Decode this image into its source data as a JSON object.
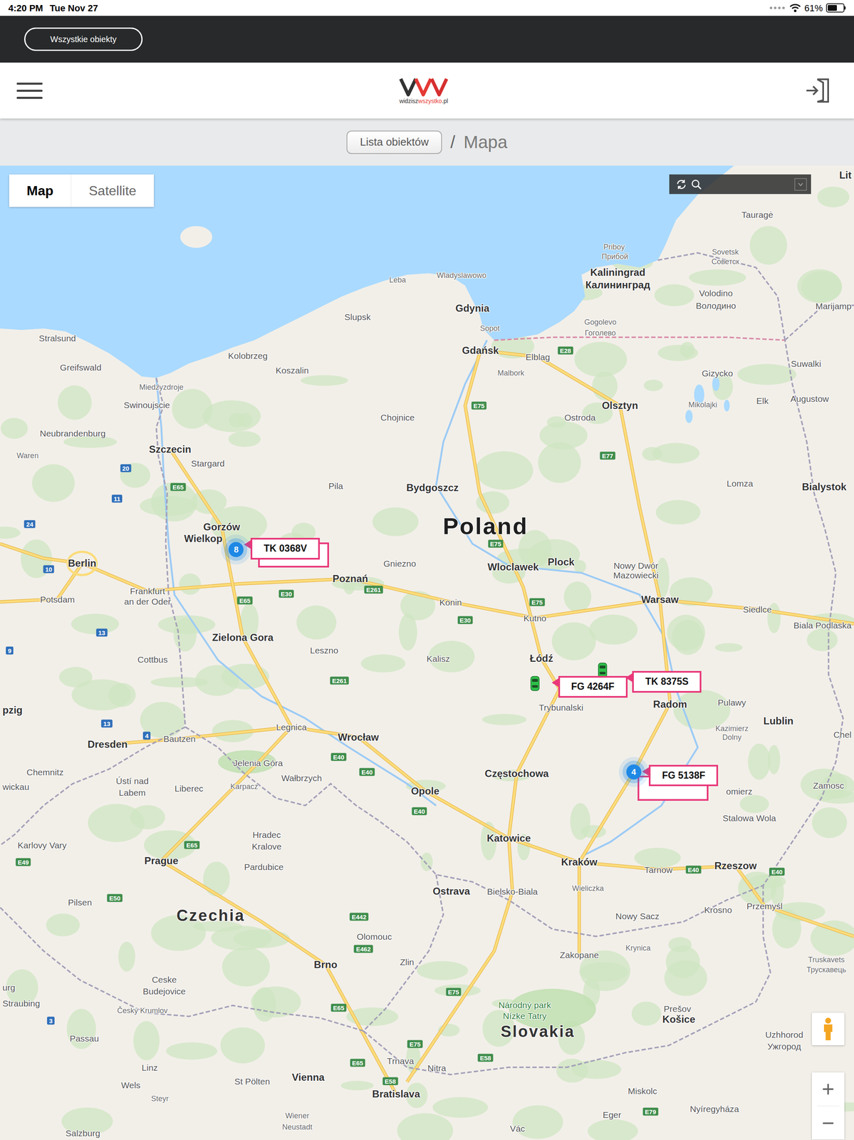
{
  "status_bar": {
    "time": "4:20 PM",
    "date": "Tue Nov 27",
    "battery": "61%",
    "battery_level": 0.61
  },
  "top_bar": {
    "button": "Wszystkie obiekty"
  },
  "header": {
    "logo": [
      {
        "text": "widzisz",
        "color": "#333333"
      },
      {
        "text": "wszystko",
        "color": "#e53935"
      },
      {
        "text": ".pl",
        "color": "#333333"
      }
    ]
  },
  "breadcrumb": {
    "items": [
      {
        "label": "Lista obiektów",
        "kind": "button"
      },
      {
        "label": "Mapa",
        "kind": "current"
      }
    ],
    "separator": "/"
  },
  "map": {
    "map_type": [
      {
        "label": "Map",
        "selected": true
      },
      {
        "label": "Satellite",
        "selected": false
      }
    ],
    "zoom_in": "+",
    "zoom_out": "−",
    "clusters": [
      {
        "count": "8"
      },
      {
        "count": "4"
      }
    ],
    "vehicles": [
      {
        "plate": "TK 0368V"
      },
      {
        "plate": "FG 4264F"
      },
      {
        "plate": "TK 8375S"
      },
      {
        "plate": "FG 5138F"
      }
    ],
    "labels": [
      {
        "text": "Lit",
        "kind": "major"
      },
      {
        "text": "Tauragė",
        "kind": "city"
      },
      {
        "text": "Priboy",
        "kind": "minor"
      },
      {
        "text": "Прибой",
        "kind": "minor"
      },
      {
        "text": "Sovetsk",
        "kind": "minor"
      },
      {
        "text": "Советск",
        "kind": "minor"
      },
      {
        "text": "Kaliningrad",
        "kind": "major"
      },
      {
        "text": "Калининград",
        "kind": "major"
      },
      {
        "text": "Volodino",
        "kind": "city"
      },
      {
        "text": "Володино",
        "kind": "city"
      },
      {
        "text": "Marijamp",
        "kind": "city"
      },
      {
        "text": "Leba",
        "kind": "minor"
      },
      {
        "text": "Wladyslawowo",
        "kind": "minor"
      },
      {
        "text": "Gdynia",
        "kind": "major"
      },
      {
        "text": "Sopot",
        "kind": "minor"
      },
      {
        "text": "Gdańsk",
        "kind": "major"
      },
      {
        "text": "Elblag",
        "kind": "city"
      },
      {
        "text": "Gogolevo",
        "kind": "minor"
      },
      {
        "text": "Гоголево",
        "kind": "minor"
      },
      {
        "text": "Slupsk",
        "kind": "city"
      },
      {
        "text": "Malbork",
        "kind": "minor"
      },
      {
        "text": "Stralsund",
        "kind": "city"
      },
      {
        "text": "Kolobrzeg",
        "kind": "city"
      },
      {
        "text": "Koszalin",
        "kind": "city"
      },
      {
        "text": "Greifswald",
        "kind": "city"
      },
      {
        "text": "Miedzyzdroje",
        "kind": "minor"
      },
      {
        "text": "Swinoujscie",
        "kind": "city"
      },
      {
        "text": "Chojnice",
        "kind": "city"
      },
      {
        "text": "Olsztyn",
        "kind": "major"
      },
      {
        "text": "Ostroda",
        "kind": "city"
      },
      {
        "text": "Gizycko",
        "kind": "city"
      },
      {
        "text": "Suwalki",
        "kind": "city"
      },
      {
        "text": "Mikolajki",
        "kind": "minor"
      },
      {
        "text": "Elk",
        "kind": "city"
      },
      {
        "text": "Augustow",
        "kind": "city"
      },
      {
        "text": "Neubrandenburg",
        "kind": "city"
      },
      {
        "text": "Szczecin",
        "kind": "major"
      },
      {
        "text": "Stargard",
        "kind": "city"
      },
      {
        "text": "Waren",
        "kind": "minor"
      },
      {
        "text": "Pila",
        "kind": "city"
      },
      {
        "text": "Bydgoszcz",
        "kind": "major"
      },
      {
        "text": "Lomza",
        "kind": "city"
      },
      {
        "text": "Bialystok",
        "kind": "major"
      },
      {
        "text": "Poland",
        "kind": "country"
      },
      {
        "text": "Gorzów",
        "kind": "major"
      },
      {
        "text": "Wielkop",
        "kind": "major"
      },
      {
        "text": "Gniezno",
        "kind": "city"
      },
      {
        "text": "Wloclawek",
        "kind": "major"
      },
      {
        "text": "Plock",
        "kind": "major"
      },
      {
        "text": "Nowy Dwór",
        "kind": "city"
      },
      {
        "text": "Mazowiecki",
        "kind": "city"
      },
      {
        "text": "Berlin",
        "kind": "major"
      },
      {
        "text": "Potsdam",
        "kind": "city"
      },
      {
        "text": "Frankfurt",
        "kind": "city"
      },
      {
        "text": "an der Oder",
        "kind": "city"
      },
      {
        "text": "Poznań",
        "kind": "major"
      },
      {
        "text": "Konin",
        "kind": "city"
      },
      {
        "text": "Kutno",
        "kind": "city"
      },
      {
        "text": "Warsaw",
        "kind": "major"
      },
      {
        "text": "Siedlce",
        "kind": "city"
      },
      {
        "text": "Biala Podlaska",
        "kind": "city"
      },
      {
        "text": "Zielona Gora",
        "kind": "major"
      },
      {
        "text": "Cottbus",
        "kind": "city"
      },
      {
        "text": "Leszno",
        "kind": "city"
      },
      {
        "text": "Kalisz",
        "kind": "city"
      },
      {
        "text": "Łódź",
        "kind": "major"
      },
      {
        "text": "Trybunalski",
        "kind": "city"
      },
      {
        "text": "Radom",
        "kind": "major"
      },
      {
        "text": "Pulawy",
        "kind": "city"
      },
      {
        "text": "Kazimierz",
        "kind": "minor"
      },
      {
        "text": "Dolny",
        "kind": "minor"
      },
      {
        "text": "Lublin",
        "kind": "major"
      },
      {
        "text": "Chel",
        "kind": "city"
      },
      {
        "text": "pzig",
        "kind": "major"
      },
      {
        "text": "Legnica",
        "kind": "city"
      },
      {
        "text": "Wrocław",
        "kind": "major"
      },
      {
        "text": "Dresden",
        "kind": "major"
      },
      {
        "text": "Bautzen",
        "kind": "city"
      },
      {
        "text": "Jelenia Góra",
        "kind": "city"
      },
      {
        "text": "Wałbrzych",
        "kind": "city"
      },
      {
        "text": "Częstochowa",
        "kind": "major"
      },
      {
        "text": "omierz",
        "kind": "city"
      },
      {
        "text": "Zamosc",
        "kind": "city"
      },
      {
        "text": "Opole",
        "kind": "major"
      },
      {
        "text": "Chemnitz",
        "kind": "city"
      },
      {
        "text": "Ústí nad",
        "kind": "city"
      },
      {
        "text": "Labem",
        "kind": "city"
      },
      {
        "text": "Liberec",
        "kind": "city"
      },
      {
        "text": "Karpacz",
        "kind": "minor"
      },
      {
        "text": "wickau",
        "kind": "city"
      },
      {
        "text": "Stalowa Wola",
        "kind": "city"
      },
      {
        "text": "Hradec",
        "kind": "city"
      },
      {
        "text": "Kralove",
        "kind": "city"
      },
      {
        "text": "Pardubice",
        "kind": "city"
      },
      {
        "text": "Katowice",
        "kind": "major"
      },
      {
        "text": "Kraków",
        "kind": "major"
      },
      {
        "text": "Tarnow",
        "kind": "city"
      },
      {
        "text": "Rzeszow",
        "kind": "major"
      },
      {
        "text": "Przemyśl",
        "kind": "city"
      },
      {
        "text": "Karlovy Vary",
        "kind": "city"
      },
      {
        "text": "Prague",
        "kind": "major"
      },
      {
        "text": "Czechia",
        "kind": "country2"
      },
      {
        "text": "Ostrava",
        "kind": "major"
      },
      {
        "text": "Bielsko-Biala",
        "kind": "city"
      },
      {
        "text": "Wieliczka",
        "kind": "minor"
      },
      {
        "text": "Nowy Sacz",
        "kind": "city"
      },
      {
        "text": "Krosno",
        "kind": "city"
      },
      {
        "text": "Pilsen",
        "kind": "city"
      },
      {
        "text": "Olomouc",
        "kind": "city"
      },
      {
        "text": "Zlin",
        "kind": "city"
      },
      {
        "text": "Zakopane",
        "kind": "city"
      },
      {
        "text": "Krynica",
        "kind": "minor"
      },
      {
        "text": "Truskavets",
        "kind": "minor"
      },
      {
        "text": "Трускавець",
        "kind": "minor"
      },
      {
        "text": "Ceske",
        "kind": "city"
      },
      {
        "text": "Budejovice",
        "kind": "city"
      },
      {
        "text": "Brno",
        "kind": "major"
      },
      {
        "text": "Prešov",
        "kind": "city"
      },
      {
        "text": "Národný park",
        "kind": "park"
      },
      {
        "text": "Nízke Tatry",
        "kind": "park"
      },
      {
        "text": "Slovakia",
        "kind": "country2"
      },
      {
        "text": "Košice",
        "kind": "major"
      },
      {
        "text": "Uzhhorod",
        "kind": "city"
      },
      {
        "text": "Ужгород",
        "kind": "city"
      },
      {
        "text": "Straubing",
        "kind": "city"
      },
      {
        "text": "urg",
        "kind": "city"
      },
      {
        "text": "Český Krumlov",
        "kind": "minor"
      },
      {
        "text": "Passau",
        "kind": "city"
      },
      {
        "text": "Linz",
        "kind": "city"
      },
      {
        "text": "Wels",
        "kind": "city"
      },
      {
        "text": "Steyr",
        "kind": "minor"
      },
      {
        "text": "St Pölten",
        "kind": "city"
      },
      {
        "text": "Vienna",
        "kind": "major"
      },
      {
        "text": "Trnava",
        "kind": "city"
      },
      {
        "text": "Nitra",
        "kind": "city"
      },
      {
        "text": "Bratislava",
        "kind": "major"
      },
      {
        "text": "Wiener",
        "kind": "minor"
      },
      {
        "text": "Neustadt",
        "kind": "minor"
      },
      {
        "text": "Salzburg",
        "kind": "city"
      },
      {
        "text": "Miskolc",
        "kind": "city"
      },
      {
        "text": "Nyíregyháza",
        "kind": "city"
      },
      {
        "text": "Eger",
        "kind": "city"
      },
      {
        "text": "Vác",
        "kind": "city"
      },
      {
        "text": "E28",
        "kind": "eroad"
      },
      {
        "text": "E75",
        "kind": "eroad"
      },
      {
        "text": "E77",
        "kind": "eroad"
      },
      {
        "text": "E65",
        "kind": "eroad"
      },
      {
        "text": "20",
        "kind": "road"
      },
      {
        "text": "11",
        "kind": "road"
      },
      {
        "text": "24",
        "kind": "road"
      },
      {
        "text": "10",
        "kind": "road"
      },
      {
        "text": "E65",
        "kind": "eroad"
      },
      {
        "text": "E30",
        "kind": "eroad"
      },
      {
        "text": "E261",
        "kind": "eroad"
      },
      {
        "text": "E75",
        "kind": "eroad"
      },
      {
        "text": "E75",
        "kind": "eroad"
      },
      {
        "text": "E30",
        "kind": "eroad"
      },
      {
        "text": "13",
        "kind": "road"
      },
      {
        "text": "E261",
        "kind": "eroad"
      },
      {
        "text": "9",
        "kind": "road"
      },
      {
        "text": "13",
        "kind": "road"
      },
      {
        "text": "4",
        "kind": "road"
      },
      {
        "text": "E40",
        "kind": "eroad"
      },
      {
        "text": "E40",
        "kind": "eroad"
      },
      {
        "text": "E40",
        "kind": "eroad"
      },
      {
        "text": "E65",
        "kind": "eroad"
      },
      {
        "text": "E49",
        "kind": "eroad"
      },
      {
        "text": "E50",
        "kind": "eroad"
      },
      {
        "text": "E442",
        "kind": "eroad"
      },
      {
        "text": "E462",
        "kind": "eroad"
      },
      {
        "text": "E75",
        "kind": "eroad"
      },
      {
        "text": "E65",
        "kind": "eroad"
      },
      {
        "text": "3",
        "kind": "road"
      },
      {
        "text": "E75",
        "kind": "eroad"
      },
      {
        "text": "E58",
        "kind": "eroad"
      },
      {
        "text": "E65",
        "kind": "eroad"
      },
      {
        "text": "E58",
        "kind": "eroad"
      },
      {
        "text": "E40",
        "kind": "eroad"
      },
      {
        "text": "E40",
        "kind": "eroad"
      },
      {
        "text": "E79",
        "kind": "eroad"
      }
    ]
  }
}
